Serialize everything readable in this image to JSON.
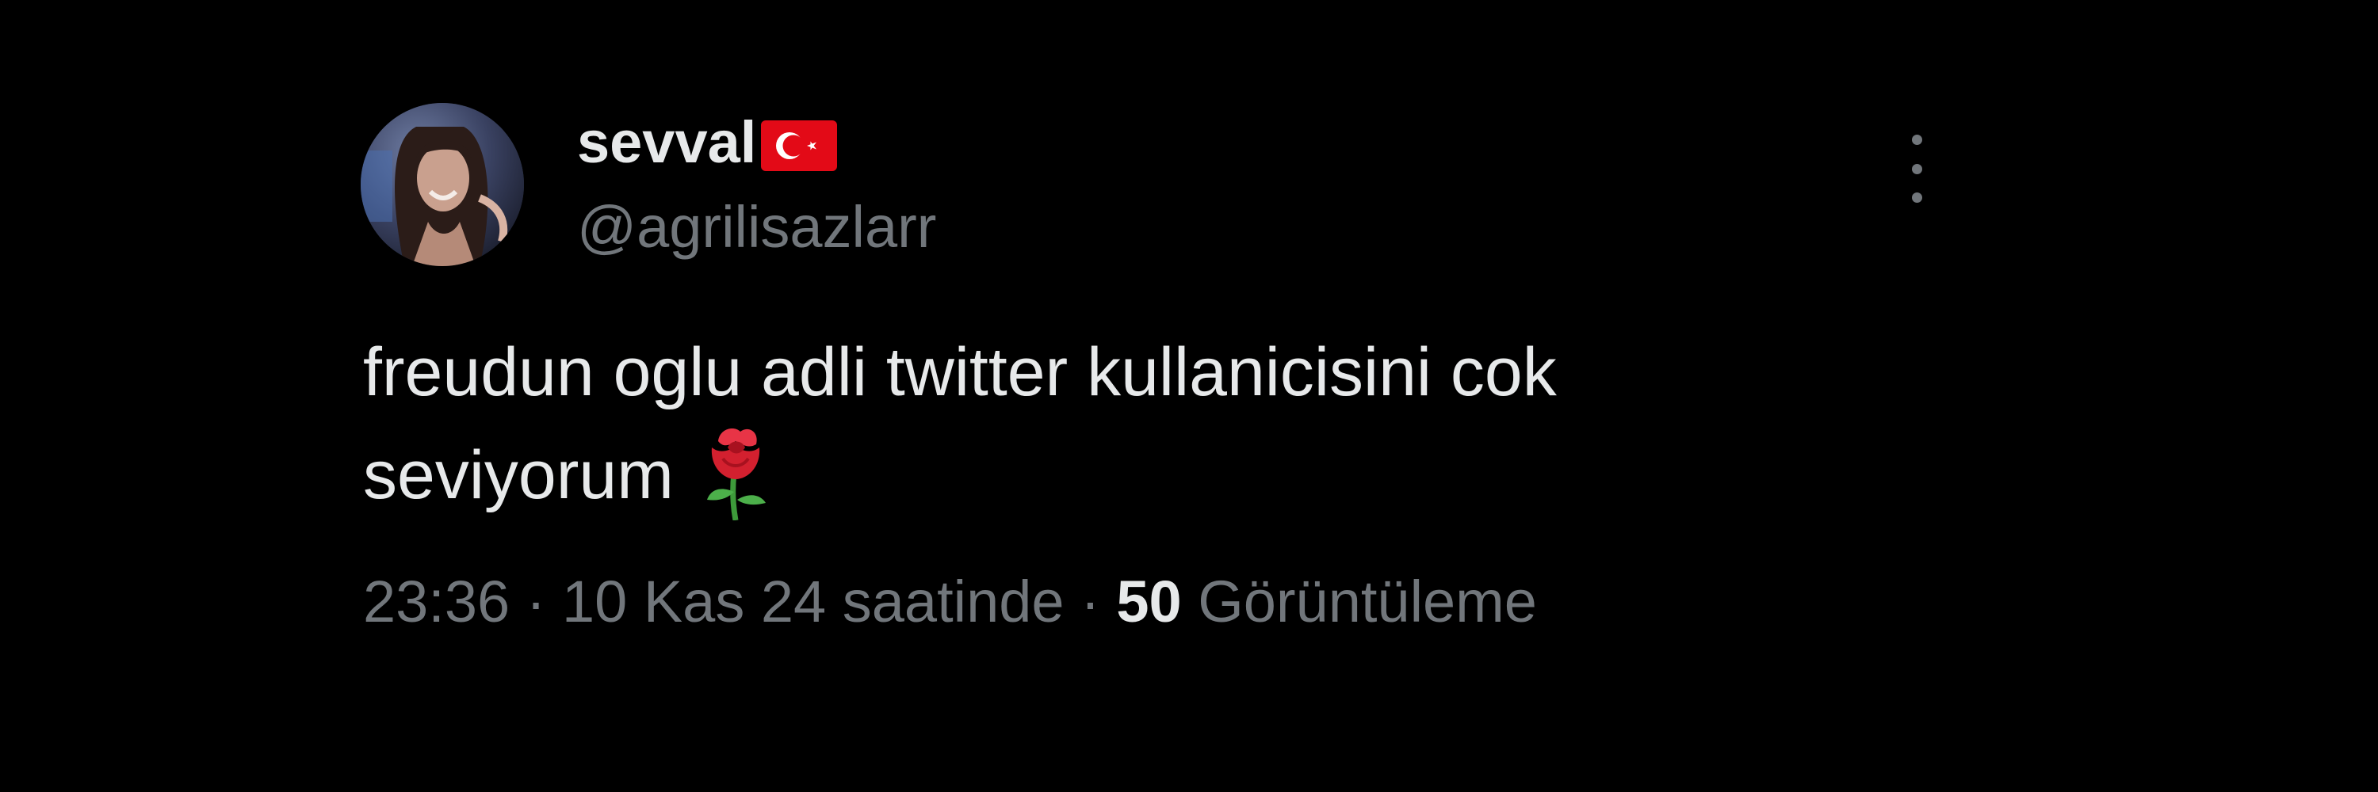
{
  "user": {
    "display_name": "sevval",
    "flag_icon": "turkey-flag-icon",
    "handle": "@agrilisazlarr"
  },
  "tweet": {
    "text_line1": "freudun oglu adli twitter kullanicisini cok",
    "text_line2": "seviyorum",
    "emoji_icon": "rose-emoji-icon"
  },
  "meta": {
    "time": "23:36",
    "separator": " · ",
    "date": "10 Kas 24 saatinde",
    "views_count": "50",
    "views_label": "Görüntüleme"
  },
  "colors": {
    "background": "#000000",
    "primary_text": "#e7e9ea",
    "secondary_text": "#71767b",
    "flag_red": "#e30a17"
  },
  "icons": {
    "more": "more-vertical-icon",
    "avatar": "avatar"
  }
}
